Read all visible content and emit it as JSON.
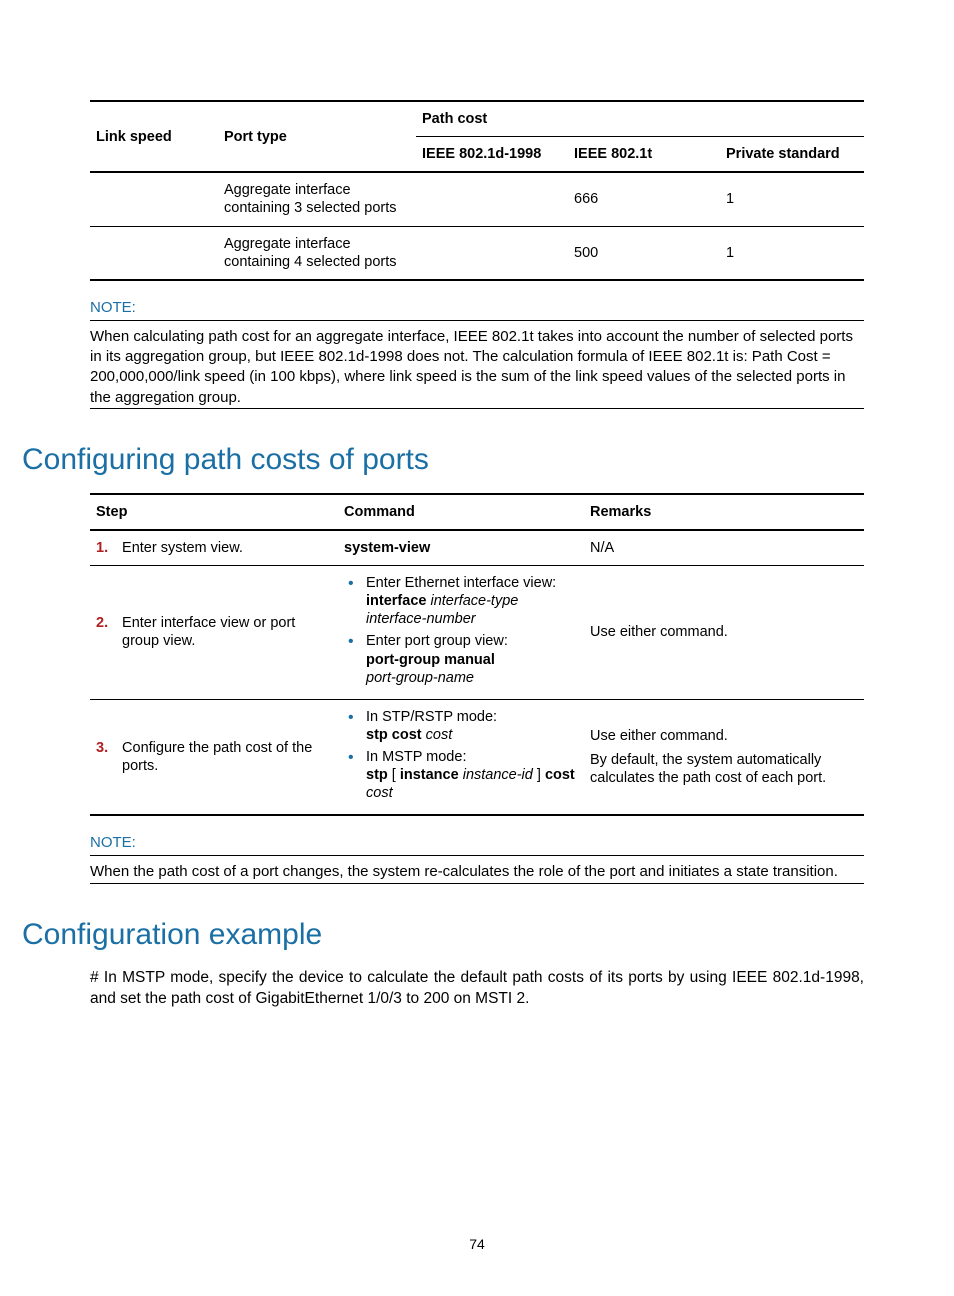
{
  "table1": {
    "hdr_linkspeed": "Link speed",
    "hdr_porttype": "Port type",
    "hdr_pathcost": "Path cost",
    "hdr_ieee1998": "IEEE 802.1d-1998",
    "hdr_ieee1t": "IEEE 802.1t",
    "hdr_priv": "Private standard",
    "rows": [
      {
        "porttype": "Aggregate interface containing 3 selected ports",
        "ieee1998": "",
        "ieee1t": "666",
        "priv": "1"
      },
      {
        "porttype": "Aggregate interface containing 4 selected ports",
        "ieee1998": "",
        "ieee1t": "500",
        "priv": "1"
      }
    ]
  },
  "note1": {
    "label": "NOTE:",
    "body": "When calculating path cost for an aggregate interface, IEEE 802.1t takes into account the number of selected ports in its aggregation group, but IEEE 802.1d-1998 does not. The calculation formula of IEEE 802.1t is: Path Cost = 200,000,000/link speed (in 100 kbps), where link speed is the sum of the link speed values of the selected ports in the aggregation group."
  },
  "heading1": "Configuring path costs of ports",
  "table2": {
    "hdr_step": "Step",
    "hdr_cmd": "Command",
    "hdr_rmk": "Remarks",
    "row1": {
      "num": "1.",
      "step": "Enter system view.",
      "cmd": "system-view",
      "rmk": "N/A"
    },
    "row2": {
      "num": "2.",
      "step": "Enter interface view or port group view.",
      "bul1_pre": "Enter Ethernet interface view:",
      "bul1_bold": "interface",
      "bul1_ital": "interface-type interface-number",
      "bul2_pre": "Enter port group view:",
      "bul2_bold": "port-group manual",
      "bul2_ital": "port-group-name",
      "rmk": "Use either command."
    },
    "row3": {
      "num": "3.",
      "step": "Configure the path cost of the ports.",
      "bul1_pre": "In STP/RSTP mode:",
      "bul1_bold": "stp cost",
      "bul1_ital": "cost",
      "bul2_pre": "In MSTP mode:",
      "bul2_b1": "stp",
      "bul2_br1": "[",
      "bul2_b2": "instance",
      "bul2_it": "instance-id",
      "bul2_br2": "]",
      "bul2_b3": "cost",
      "bul2_it2": "cost",
      "rmk1": "Use either command.",
      "rmk2": "By default, the system automatically calculates the path cost of each port."
    }
  },
  "note2": {
    "label": "NOTE:",
    "body": "When the path cost of a port changes, the system re-calculates the role of the port and initiates a state transition."
  },
  "heading2": "Configuration example",
  "para1": "# In MSTP mode, specify the device to calculate the default path costs of its ports by using IEEE 802.1d-1998, and set the path cost of GigabitEthernet 1/0/3 to 200 on MSTI 2.",
  "pagenum": "74"
}
